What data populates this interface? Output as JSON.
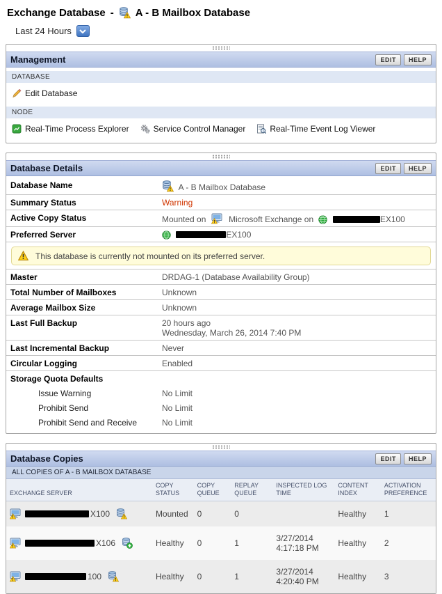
{
  "page": {
    "title": "Exchange Database",
    "separator": "-",
    "database_name": "A - B Mailbox Database",
    "time_filter": "Last 24 Hours"
  },
  "actions": {
    "edit": "EDIT",
    "help": "HELP"
  },
  "management": {
    "title": "Management",
    "database_section_label": "DATABASE",
    "edit_database_label": "Edit Database",
    "node_section_label": "NODE",
    "node_links": {
      "process_explorer": "Real-Time Process Explorer",
      "service_control": "Service Control Manager",
      "event_log": "Real-Time Event Log Viewer"
    }
  },
  "details": {
    "title": "Database Details",
    "database_name_label": "Database Name",
    "database_name_value": "A - B Mailbox Database",
    "summary_status_label": "Summary Status",
    "summary_status_value": "Warning",
    "active_copy_label": "Active Copy Status",
    "active_copy_prefix": "Mounted on",
    "active_copy_middle": "Microsoft Exchange on",
    "active_copy_server_suffix": "EX100",
    "preferred_server_label": "Preferred Server",
    "preferred_server_suffix": "EX100",
    "warning_message": "This database is currently not mounted on its preferred server.",
    "master_label": "Master",
    "master_value": "DRDAG-1 (Database Availability Group)",
    "total_mailboxes_label": "Total Number of Mailboxes",
    "total_mailboxes_value": "Unknown",
    "avg_mailbox_label": "Average Mailbox Size",
    "avg_mailbox_value": "Unknown",
    "last_full_backup_label": "Last Full Backup",
    "last_full_backup_relative": "20 hours ago",
    "last_full_backup_date": "Wednesday, March 26, 2014 7:40 PM",
    "last_incremental_label": "Last Incremental Backup",
    "last_incremental_value": "Never",
    "circular_logging_label": "Circular Logging",
    "circular_logging_value": "Enabled",
    "storage_quota_label": "Storage Quota Defaults",
    "issue_warning_label": "Issue Warning",
    "issue_warning_value": "No Limit",
    "prohibit_send_label": "Prohibit Send",
    "prohibit_send_value": "No Limit",
    "prohibit_send_receive_label": "Prohibit Send and Receive",
    "prohibit_send_receive_value": "No Limit"
  },
  "copies": {
    "title": "Database Copies",
    "subtitle": "ALL COPIES OF A - B MAILBOX DATABASE",
    "columns": {
      "server": "EXCHANGE SERVER",
      "copy_status": "COPY STATUS",
      "copy_queue": "COPY QUEUE",
      "replay_queue": "REPLAY QUEUE",
      "inspected": "INSPECTED LOG TIME",
      "content_index": "CONTENT INDEX",
      "activation": "ACTIVATION PREFERENCE"
    },
    "rows": [
      {
        "server_suffix": "X100",
        "copy_status": "Mounted",
        "copy_queue": "0",
        "replay_queue": "0",
        "inspected": "",
        "content_index": "Healthy",
        "activation": "1",
        "db_state": "warning"
      },
      {
        "server_suffix": "X106",
        "copy_status": "Healthy",
        "copy_queue": "0",
        "replay_queue": "1",
        "inspected": "3/27/2014 4:17:18 PM",
        "content_index": "Healthy",
        "activation": "2",
        "db_state": "healthy"
      },
      {
        "server_suffix": "100",
        "copy_status": "Healthy",
        "copy_queue": "0",
        "replay_queue": "1",
        "inspected": "3/27/2014 4:20:40 PM",
        "content_index": "Healthy",
        "activation": "3",
        "db_state": "warning"
      }
    ]
  },
  "colors": {
    "accent_blue": "#3f74c0",
    "warning_text": "#d03500",
    "banner_bg": "#fffcda"
  }
}
